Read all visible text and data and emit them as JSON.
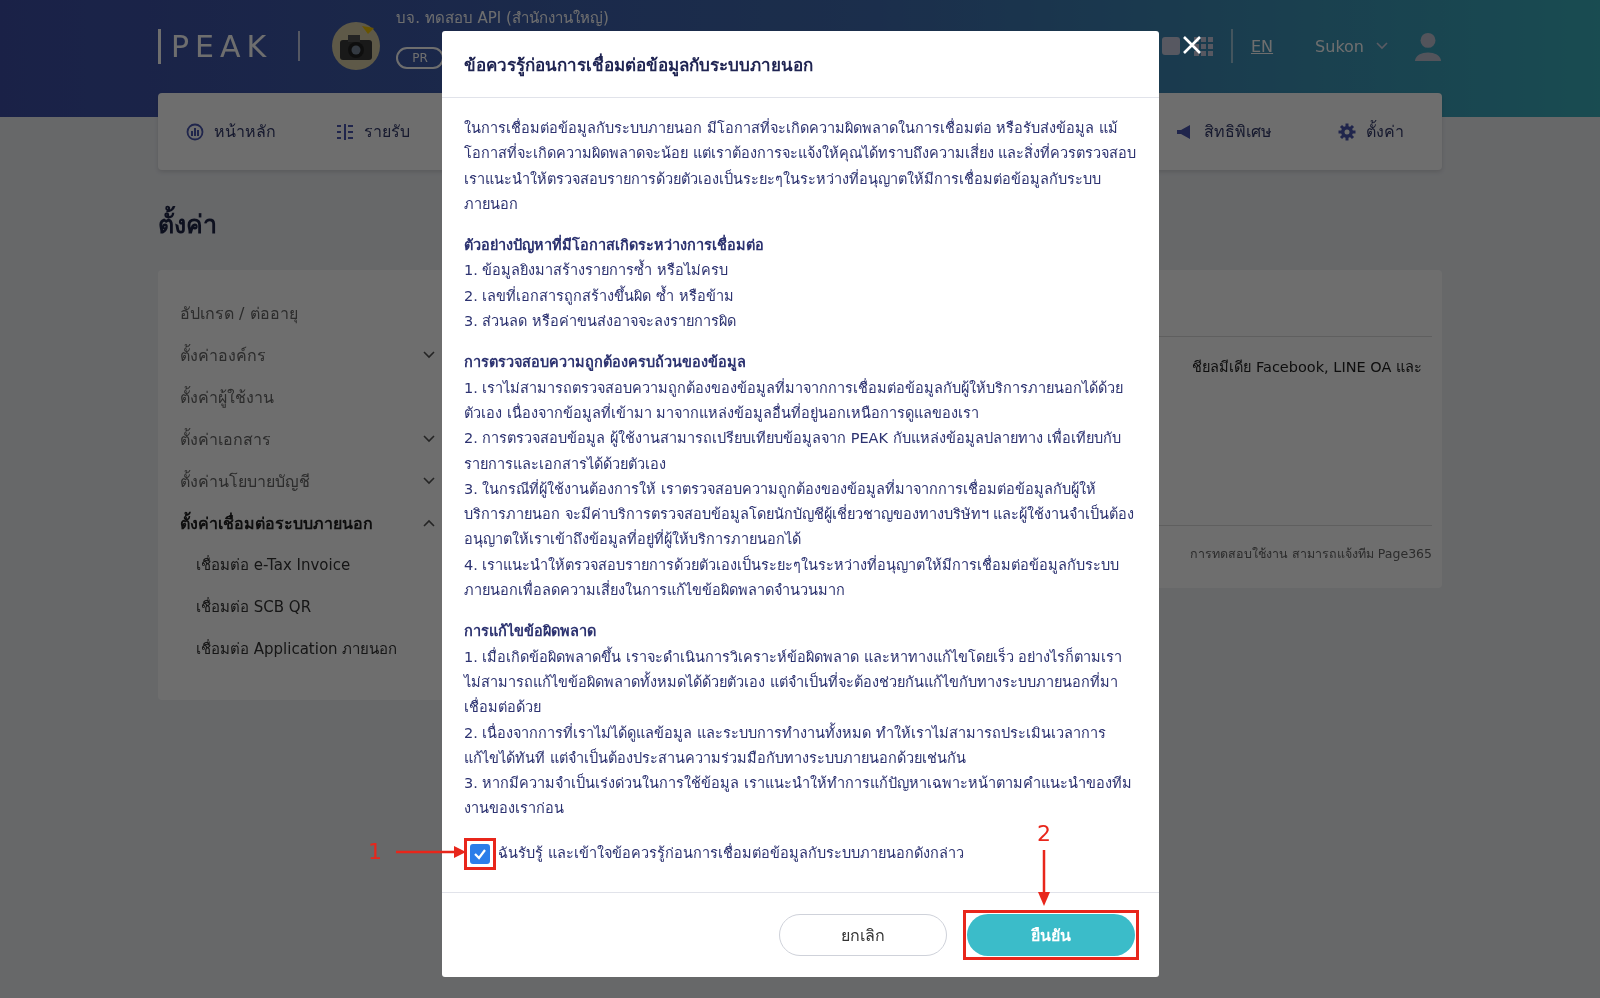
{
  "header": {
    "logo": "PEAK",
    "company": "บจ. ทดสอบ API (สำนักงานใหญ่)",
    "plan_badge": "PR",
    "language": "EN",
    "user": "Sukon"
  },
  "nav": [
    {
      "label": "หน้าหลัก"
    },
    {
      "label": "รายรับ"
    },
    {
      "label": "สิทธิพิเศษ"
    },
    {
      "label": "ตั้งค่า"
    }
  ],
  "page_title": "ตั้งค่า",
  "sidebar": [
    {
      "label": "อัปเกรด / ต่ออายุ",
      "expandable": false,
      "expanded": false
    },
    {
      "label": "ตั้งค่าองค์กร",
      "expandable": true,
      "expanded": false
    },
    {
      "label": "ตั้งค่าผู้ใช้งาน",
      "expandable": false,
      "expanded": false
    },
    {
      "label": "ตั้งค่าเอกสาร",
      "expandable": true,
      "expanded": false
    },
    {
      "label": "ตั้งค่านโยบายบัญชี",
      "expandable": true,
      "expanded": false
    },
    {
      "label": "ตั้งค่าเชื่อมต่อระบบภายนอก",
      "expandable": true,
      "expanded": true,
      "children": [
        {
          "label": "เชื่อมต่อ e-Tax Invoice"
        },
        {
          "label": "เชื่อมต่อ SCB QR"
        },
        {
          "label": "เชื่อมต่อ Application ภายนอก"
        }
      ]
    }
  ],
  "content_texts": [
    "ชียลมีเดีย Facebook, LINE OA และ",
    "การทดสอบใช้งาน สามารถแจ้งทีม Page365"
  ],
  "modal": {
    "title": "ข้อควรรู้ก่อนการเชื่อมต่อข้อมูลกับระบบภายนอก",
    "intro": "ในการเชื่อมต่อข้อมูลกับระบบภายนอก มีโอกาสที่จะเกิดความผิดพลาดในการเชื่อมต่อ หรือรับส่งข้อมูล แม้โอกาสที่จะเกิดความผิดพลาดจะน้อย แต่เราต้องการจะแจ้งให้คุณได้ทราบถึงความเสี่ยง และสิ่งที่ควรตรวจสอบ เราแนะนำให้ตรวจสอบรายการด้วยตัวเองเป็นระยะๆในระหว่างที่อนุญาตให้มีการเชื่อมต่อข้อมูลกับระบบภายนอก",
    "sections": [
      {
        "heading": "ตัวอย่างปัญหาที่มีโอกาสเกิดระหว่างการเชื่อมต่อ",
        "items": [
          "1. ข้อมูลยิงมาสร้างรายการซ้ำ หรือไม่ครบ",
          "2. เลขที่เอกสารถูกสร้างขึ้นผิด ซ้ำ หรือข้าม",
          "3. ส่วนลด หรือค่าขนส่งอาจจะลงรายการผิด"
        ]
      },
      {
        "heading": "การตรวจสอบความถูกต้องครบถ้วนของข้อมูล",
        "items": [
          "1. เราไม่สามารถตรวจสอบความถูกต้องของข้อมูลที่มาจากการเชื่อมต่อข้อมูลกับผู้ให้บริการภายนอกได้ด้วยตัวเอง เนื่องจากข้อมูลที่เข้ามา มาจากแหล่งข้อมูลอื่นที่อยู่นอกเหนือการดูแลของเรา",
          "2. การตรวจสอบข้อมูล ผู้ใช้งานสามารถเปรียบเทียบข้อมูลจาก PEAK กับแหล่งข้อมูลปลายทาง เพื่อเทียบกับรายการและเอกสารได้ด้วยตัวเอง",
          "3. ในกรณีที่ผู้ใช้งานต้องการให้ เราตรวจสอบความถูกต้องของข้อมูลที่มาจากการเชื่อมต่อข้อมูลกับผู้ให้บริการภายนอก จะมีค่าบริการตรวจสอบข้อมูลโดยนักบัญชีผู้เชี่ยวชาญของทางบริษัทฯ และผู้ใช้งานจำเป็นต้องอนุญาตให้เราเข้าถึงข้อมูลที่อยู่ที่ผู้ให้บริการภายนอกได้",
          "4. เราแนะนำให้ตรวจสอบรายการด้วยตัวเองเป็นระยะๆในระหว่างที่อนุญาตให้มีการเชื่อมต่อข้อมูลกับระบบภายนอกเพื่อลดความเสี่ยงในการแก้ไขข้อผิดพลาดจำนวนมาก"
        ]
      },
      {
        "heading": "การแก้ไขข้อผิดพลาด",
        "items": [
          "1. เมื่อเกิดข้อผิดพลาดขึ้น เราจะดำเนินการวิเคราะห์ข้อผิดพลาด และหาทางแก้ไขโดยเร็ว อย่างไรก็ตามเราไม่สามารถแก้ไขข้อผิดพลาดทั้งหมดได้ด้วยตัวเอง แต่จำเป็นที่จะต้องช่วยกันแก้ไขกับทางระบบภายนอกที่มาเชื่อมต่อด้วย",
          "2. เนื่องจากการที่เราไม่ได้ดูแลข้อมูล และระบบการทำงานทั้งหมด ทำให้เราไม่สามารถประเมินเวลาการแก้ไขได้ทันที แต่จำเป็นต้องประสานความร่วมมือกับทางระบบภายนอกด้วยเช่นกัน",
          "3. หากมีความจำเป็นเร่งด่วนในการใช้ข้อมูล เราแนะนำให้ทำการแก้ปัญหาเฉพาะหน้าตามคำแนะนำของทีมงานของเราก่อน"
        ]
      }
    ],
    "consent": {
      "label": "ฉันรับรู้ และเข้าใจข้อควรรู้ก่อนการเชื่อมต่อข้อมูลกับระบบภายนอกดังกล่าว",
      "checked": true,
      "annotation": "1"
    },
    "buttons": [
      {
        "label": "ยกเลิก",
        "kind": "secondary"
      },
      {
        "label": "ยืนยัน",
        "kind": "primary",
        "annotation": "2"
      }
    ]
  }
}
